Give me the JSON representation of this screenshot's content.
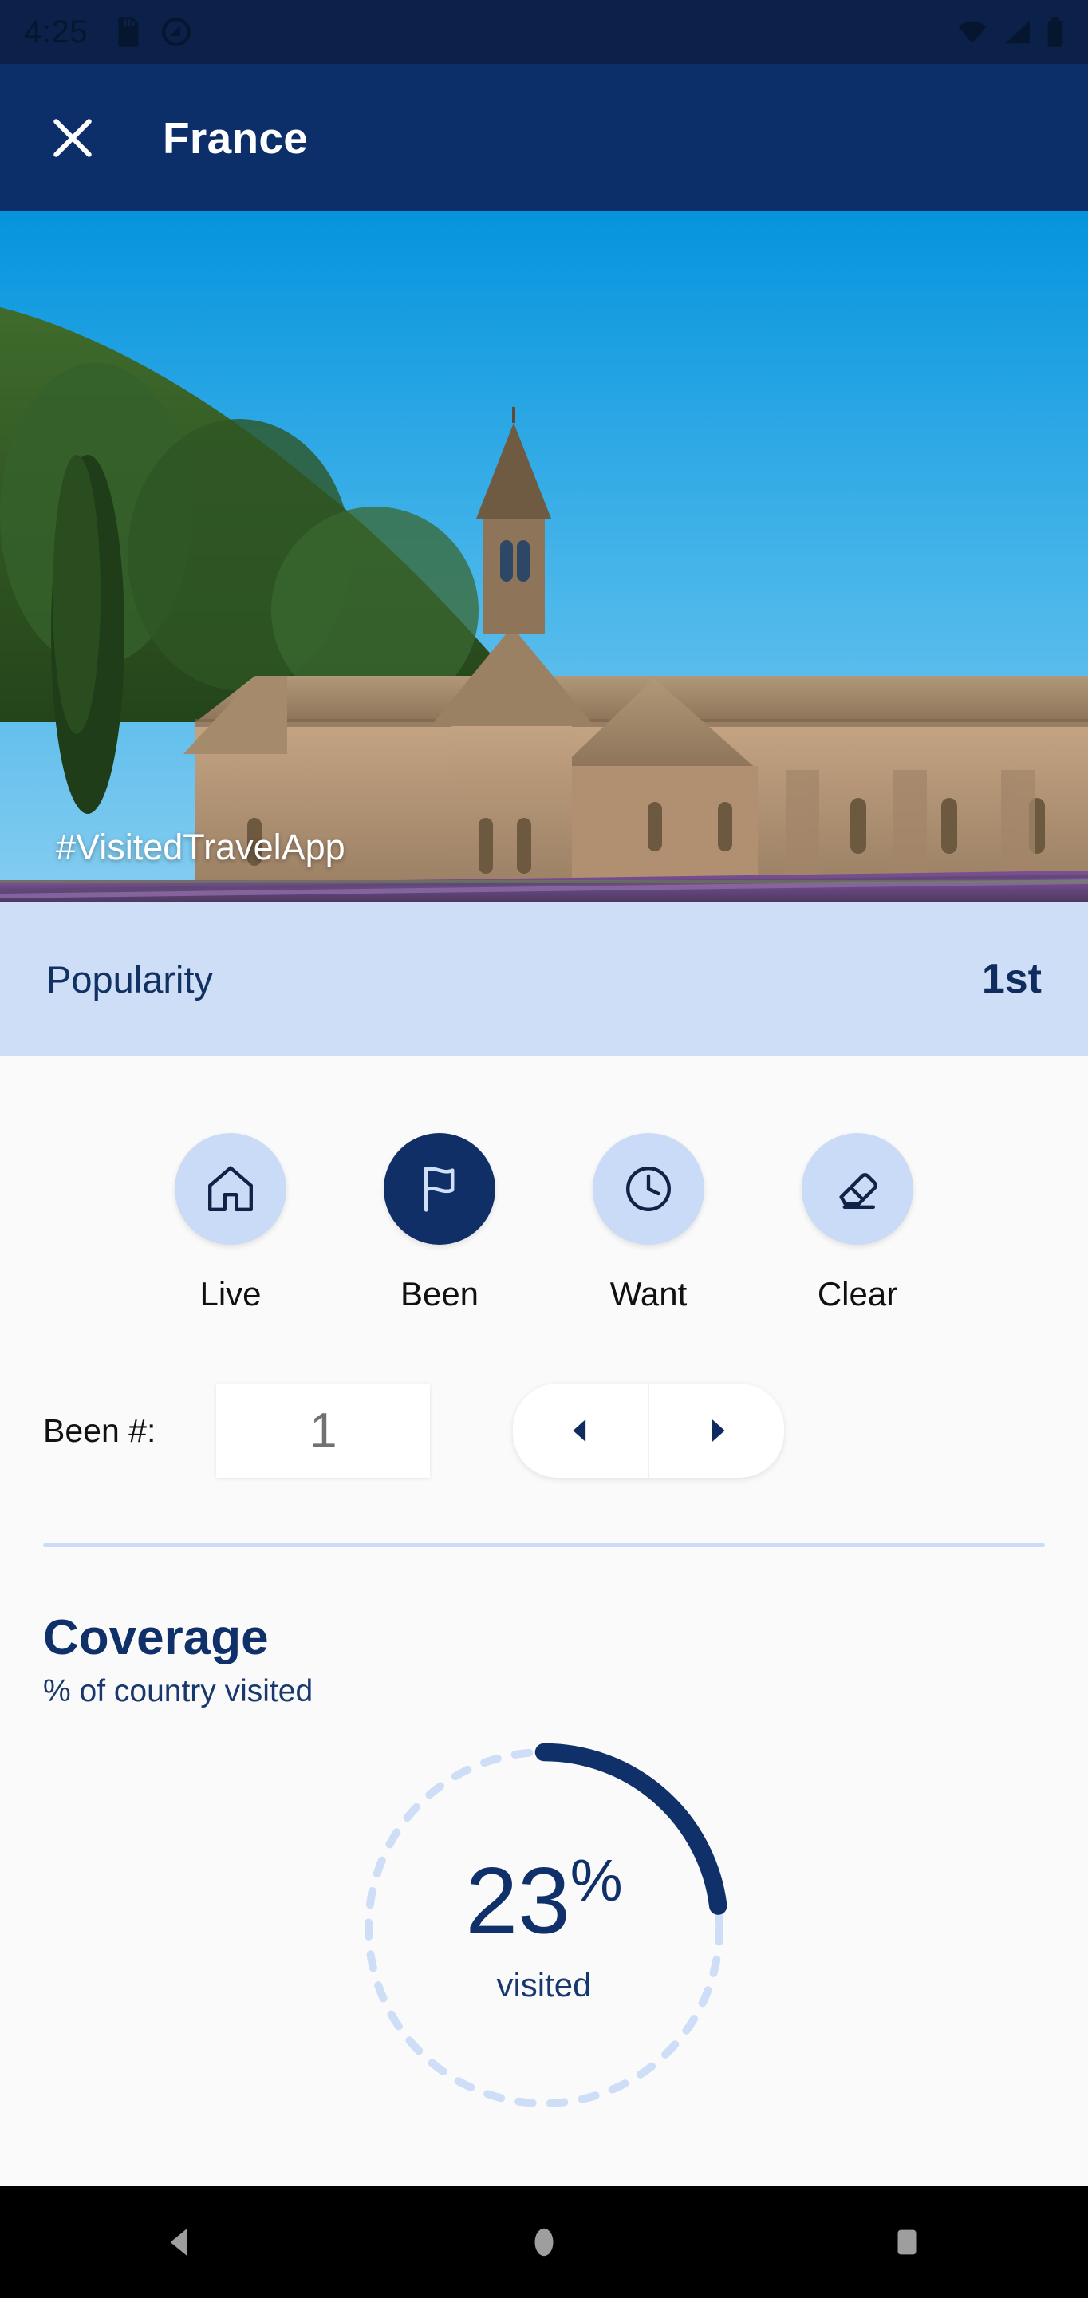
{
  "status_bar": {
    "time": "4:25",
    "left_icons": [
      "sd-card-icon",
      "do-not-disturb-icon"
    ],
    "right_icons": [
      "wifi-icon",
      "cell-signal-icon",
      "battery-icon"
    ]
  },
  "app_bar": {
    "close_icon": "close-icon",
    "title": "France"
  },
  "hero": {
    "hashtag": "#VisitedTravelApp",
    "photo_description": "senanque-abbey-lavender-field"
  },
  "popularity": {
    "label": "Popularity",
    "value": "1st"
  },
  "actions": [
    {
      "label": "Live",
      "icon": "home-icon",
      "active": false
    },
    {
      "label": "Been",
      "icon": "flag-icon",
      "active": true
    },
    {
      "label": "Want",
      "icon": "clock-icon",
      "active": false
    },
    {
      "label": "Clear",
      "icon": "eraser-icon",
      "active": false
    }
  ],
  "stepper": {
    "label": "Been #:",
    "value": "1",
    "decrement_icon": "triangle-left-icon",
    "increment_icon": "triangle-right-icon"
  },
  "coverage": {
    "title": "Coverage",
    "subtitle": "% of country visited",
    "percent_text": "23",
    "percent_symbol": "%",
    "caption": "visited"
  },
  "nav_bar": {
    "back_icon": "back-triangle-icon",
    "home_icon": "home-circle-icon",
    "recents_icon": "recents-square-icon"
  },
  "chart_data": {
    "type": "pie",
    "title": "Coverage",
    "subtitle": "% of country visited",
    "categories": [
      "visited",
      "not visited"
    ],
    "values": [
      23,
      77
    ],
    "value_label": "23%",
    "accent_color": "#10306a",
    "track_color": "#cfdef7",
    "start_angle_deg": 0,
    "direction": "clockwise"
  },
  "colors": {
    "brand_navy": "#0d2f69",
    "status_navy": "#0b2149",
    "light_blue": "#cfdef7",
    "icon_circle": "#c9dbf6",
    "page_bg": "#fafafa"
  }
}
